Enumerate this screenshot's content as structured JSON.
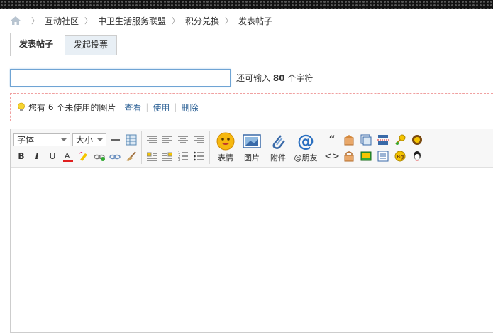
{
  "breadcrumb": [
    "互动社区",
    "中卫生活服务联盟",
    "积分兑换",
    "发表帖子"
  ],
  "tabs": [
    {
      "label": "发表帖子",
      "active": true
    },
    {
      "label": "发起投票",
      "active": false
    }
  ],
  "subject": {
    "value": "",
    "remain_prefix": "还可输入",
    "remain_count": "80",
    "remain_suffix": "个字符"
  },
  "images": {
    "text_prefix": "您有",
    "count": "6",
    "text_suffix": "个未使用的图片",
    "view": "查看",
    "use": "使用",
    "delete": "删除"
  },
  "toolbar": {
    "font_label": "字体",
    "size_label": "大小",
    "emoticon": "表情",
    "image": "图片",
    "attach": "附件",
    "at": "@朋友"
  },
  "colors": {
    "accent_border": "#6fa4d4",
    "link": "#336699",
    "tab_inactive": "#e8eff5",
    "dash": "#f0a0a0"
  }
}
